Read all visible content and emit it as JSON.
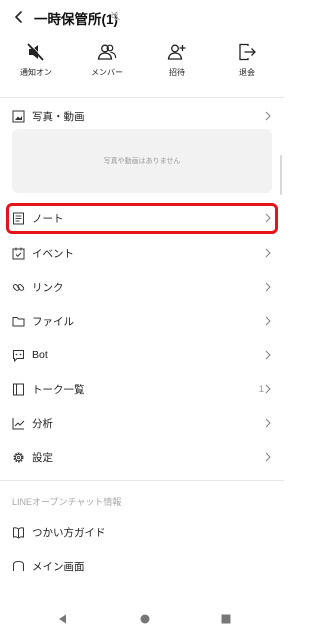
{
  "header": {
    "title": "一時保管所(1)"
  },
  "actions": [
    {
      "label": "通知オン",
      "icon": "speaker-muted-icon"
    },
    {
      "label": "メンバー",
      "icon": "members-icon"
    },
    {
      "label": "招待",
      "icon": "add-person-icon"
    },
    {
      "label": "退会",
      "icon": "leave-icon"
    }
  ],
  "photos": {
    "label": "写真・動画",
    "empty_text": "写真や動画はありません"
  },
  "menu": [
    {
      "label": "ノート",
      "count": "",
      "icon": "note-icon"
    },
    {
      "label": "イベント",
      "count": "",
      "icon": "calendar-icon"
    },
    {
      "label": "リンク",
      "count": "",
      "icon": "link-icon"
    },
    {
      "label": "ファイル",
      "count": "",
      "icon": "folder-icon"
    },
    {
      "label": "Bot",
      "count": "",
      "icon": "bot-icon"
    },
    {
      "label": "トーク一覧",
      "count": "1",
      "icon": "talk-list-icon"
    },
    {
      "label": "分析",
      "count": "",
      "icon": "analytics-icon"
    },
    {
      "label": "設定",
      "count": "",
      "icon": "gear-icon"
    }
  ],
  "section_title": "LINEオープンチャット情報",
  "info": [
    {
      "label": "つかい方ガイド",
      "icon": "guide-book-icon"
    },
    {
      "label": "メイン画面",
      "icon": "main-screen-icon"
    }
  ],
  "colors": {
    "highlight": "#e3151a",
    "empty_box": "#f2f2f2"
  }
}
